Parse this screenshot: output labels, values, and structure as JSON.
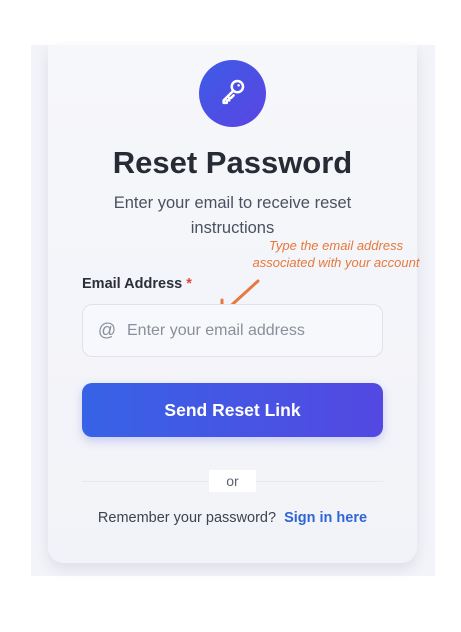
{
  "header": {
    "title": "Reset Password",
    "subtitle": "Enter your email to receive reset instructions",
    "logo_icon": "key-icon"
  },
  "form": {
    "email_label": "Email Address",
    "required_marker": "*",
    "email_placeholder": "Enter your email address",
    "email_value": "",
    "email_icon": "at-sign-icon",
    "hint": "Type the email address associated with your account",
    "submit_label": "Send Reset Link"
  },
  "divider": {
    "label": "or"
  },
  "footer": {
    "prompt": "Remember your password?",
    "link_label": "Sign in here"
  },
  "colors": {
    "accent_start": "#3763e6",
    "accent_end": "#5348e2",
    "link": "#2e66d6",
    "hint": "#e6793c",
    "required": "#e2453c"
  }
}
